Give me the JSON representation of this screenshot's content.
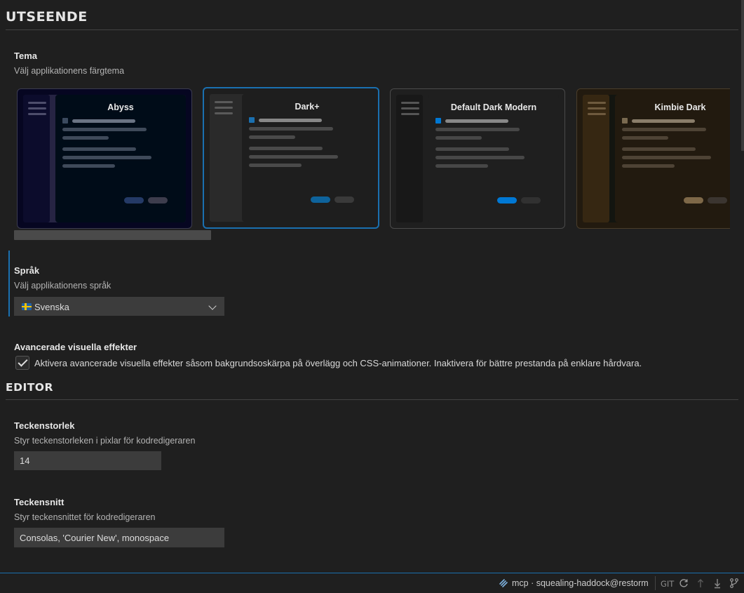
{
  "appearance": {
    "heading": "UTSEENDE",
    "theme": {
      "title": "Tema",
      "description": "Välj applikationens färgtema",
      "cards": [
        {
          "name": "Abyss",
          "selected": false
        },
        {
          "name": "Dark+",
          "selected": true
        },
        {
          "name": "Default Dark Modern",
          "selected": false
        },
        {
          "name": "Kimbie Dark",
          "selected": false
        }
      ]
    },
    "language": {
      "title": "Språk",
      "description": "Välj applikationens språk",
      "value": "Svenska",
      "flag_icon": "sweden-flag-icon"
    },
    "effects": {
      "title": "Avancerade visuella effekter",
      "checked": true,
      "label": "Aktivera avancerade visuella effekter såsom bakgrundsoskärpa på överlägg och CSS-animationer. Inaktivera för bättre prestanda på enklare hårdvara."
    }
  },
  "editor": {
    "heading": "EDITOR",
    "font_size": {
      "title": "Teckenstorlek",
      "description": "Styr teckenstorleken i pixlar för kodredigeraren",
      "value": "14"
    },
    "font_family": {
      "title": "Teckensnitt",
      "description": "Styr teckensnittet för kodredigeraren",
      "value": "Consolas, 'Courier New', monospace"
    }
  },
  "statusbar": {
    "mcp_label": "mcp · squealing-haddock@restorm",
    "git_label": "GIT",
    "icons": [
      "mcp-icon",
      "refresh-icon",
      "push-icon",
      "pull-icon",
      "branch-icon"
    ]
  },
  "colors": {
    "accent": "#1a70b0",
    "background": "#1f1f1f",
    "input_bg": "#3c3c3c"
  }
}
